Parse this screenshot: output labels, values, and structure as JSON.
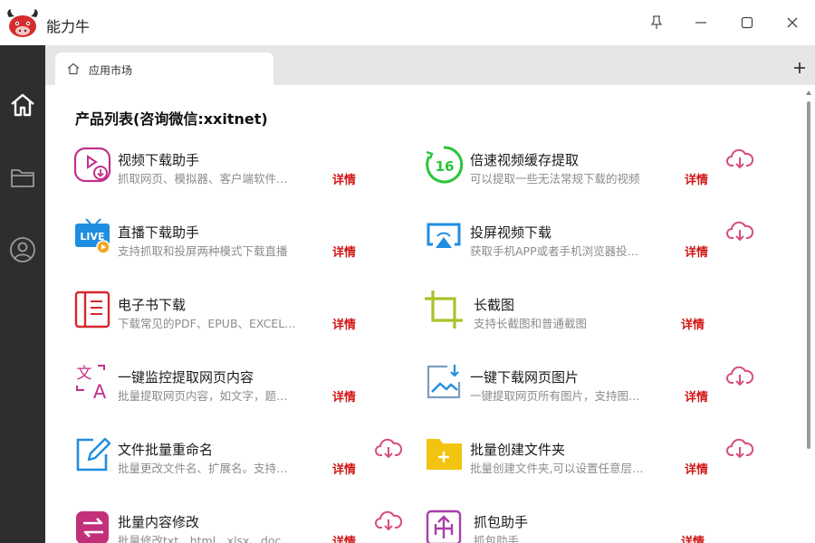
{
  "app": {
    "title": "能力牛"
  },
  "tabs": [
    {
      "label": "应用市场"
    }
  ],
  "main": {
    "heading": "产品列表(咨询微信:xxitnet)"
  },
  "products": [
    {
      "title": "视频下载助手",
      "desc": "抓取网页、模拟器、客户端软件…",
      "detail": "详情",
      "icon": "video-download-icon",
      "download": false
    },
    {
      "title": "倍速视频缓存提取",
      "desc": "可以提取一些无法常规下载的视频",
      "detail": "详情",
      "icon": "speed-16-icon",
      "download": true
    },
    {
      "title": "直播下载助手",
      "desc": "支持抓取和投屏两种模式下载直播",
      "detail": "详情",
      "icon": "live-tv-icon",
      "download": false
    },
    {
      "title": "投屏视频下载",
      "desc": "获取手机APP或者手机浏览器投…",
      "detail": "详情",
      "icon": "airplay-icon",
      "download": true
    },
    {
      "title": "电子书下载",
      "desc": "下载常见的PDF、EPUB、EXCEL…",
      "detail": "详情",
      "icon": "ebook-icon",
      "download": false
    },
    {
      "title": "长截图",
      "desc": "支持长截图和普通截图",
      "detail": "详情",
      "icon": "crop-icon",
      "download": false
    },
    {
      "title": "一键监控提取网页内容",
      "desc": "批量提取网页内容，如文字，题…",
      "detail": "详情",
      "icon": "translate-icon",
      "download": false
    },
    {
      "title": "一键下载网页图片",
      "desc": "一键提取网页所有图片，支持图…",
      "detail": "详情",
      "icon": "image-download-icon",
      "download": true
    },
    {
      "title": "文件批量重命名",
      "desc": "批量更改文件名、扩展名。支持…",
      "detail": "详情",
      "icon": "rename-icon",
      "download": true
    },
    {
      "title": "批量创建文件夹",
      "desc": "批量创建文件夹,可以设置任意层…",
      "detail": "详情",
      "icon": "folder-add-icon",
      "download": true
    },
    {
      "title": "批量内容修改",
      "desc": "批量修改txt、html、xlsx、doc…",
      "detail": "详情",
      "icon": "swap-icon",
      "download": true
    },
    {
      "title": "抓包助手",
      "desc": "抓包助手",
      "detail": "详情",
      "icon": "packet-capture-icon",
      "download": false
    }
  ],
  "colors": {
    "sidebar": "#2e2e2e",
    "tabstrip": "#e6e6e6",
    "detail": "#d01515",
    "cloud": "#d94e7a"
  }
}
